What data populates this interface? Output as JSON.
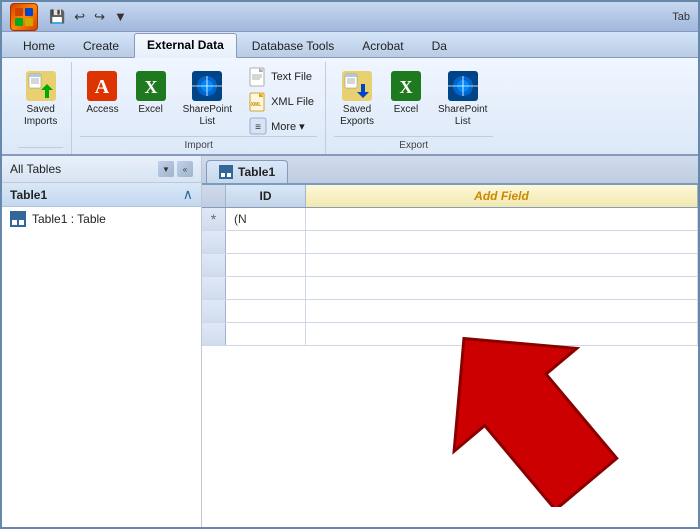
{
  "titleBar": {
    "appName": "Tab",
    "officeLogo": "◆"
  },
  "quickAccess": {
    "save": "💾",
    "undo": "↩",
    "redo": "↪",
    "customize": "▼"
  },
  "ribbonTabs": [
    {
      "id": "home",
      "label": "Home",
      "active": false
    },
    {
      "id": "create",
      "label": "Create",
      "active": false
    },
    {
      "id": "external-data",
      "label": "External Data",
      "active": true
    },
    {
      "id": "database-tools",
      "label": "Database Tools",
      "active": false
    },
    {
      "id": "acrobat",
      "label": "Acrobat",
      "active": false
    },
    {
      "id": "da",
      "label": "Da",
      "active": false
    }
  ],
  "importGroup": {
    "label": "Import",
    "savedImports": {
      "label": "Saved\nImports"
    },
    "access": {
      "label": "Access"
    },
    "excel": {
      "label": "Excel"
    },
    "sharepoint": {
      "label": "SharePoint\nList"
    },
    "textFile": {
      "label": "Text File"
    },
    "xmlFile": {
      "label": "XML File"
    },
    "more": {
      "label": "More ▾"
    }
  },
  "exportGroup": {
    "label": "Export",
    "savedExports": {
      "label": "Saved\nExports"
    },
    "excel": {
      "label": "Excel"
    },
    "sharepoint": {
      "label": "SharePoint\nList"
    }
  },
  "leftPanel": {
    "title": "All Tables",
    "filterIcon": "▼",
    "collapseIcon": "«",
    "sections": [
      {
        "title": "Table1",
        "collapseIcon": "∧",
        "items": [
          {
            "label": "Table1 : Table"
          }
        ]
      }
    ]
  },
  "tableTab": {
    "label": "Table1"
  },
  "dataGrid": {
    "headers": [
      "ID",
      "Add Field"
    ],
    "rows": [
      {
        "marker": "*",
        "id": "(N",
        "addField": ""
      }
    ]
  },
  "addFieldLabel": "Add Field"
}
